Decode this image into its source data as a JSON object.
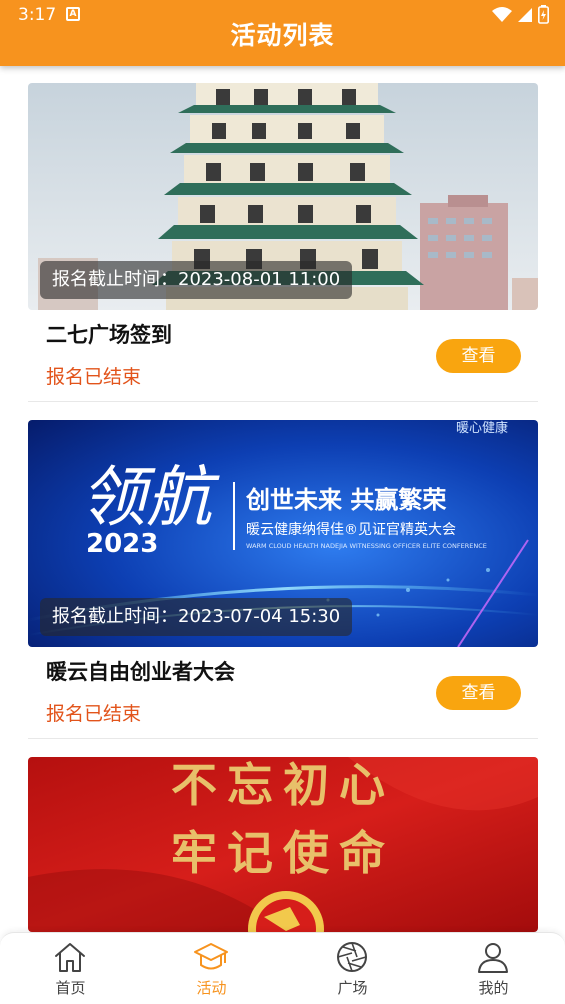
{
  "status_bar": {
    "time": "3:17",
    "notification_glyph": "A"
  },
  "header": {
    "title": "活动列表"
  },
  "events": [
    {
      "image": "pagoda-photo",
      "deadline": "报名截止时间：2023-08-01 11:00",
      "name": "二七广场签到",
      "status": "报名已结束",
      "action": "查看"
    },
    {
      "image": "conference-banner",
      "banner": {
        "corner_text": "暖心健康",
        "calligraphy": "领航",
        "year": "2023",
        "slogan": "创世未来   共赢繁荣",
        "subtitle": "暖云健康纳得佳®见证官精英大会",
        "subtitle_en": "WARM CLOUD HEALTH NADEJIA WITNESSING OFFICER ELITE CONFERENCE"
      },
      "deadline": "报名截止时间：2023-07-04 15:30",
      "name": "暖云自由创业者大会",
      "status": "报名已结束",
      "action": "查看"
    },
    {
      "image": "party-banner",
      "banner": {
        "line1": "不忘初心",
        "line2": "牢记使命"
      }
    }
  ],
  "tabbar": [
    {
      "label": "首页",
      "icon": "home-icon",
      "active": false
    },
    {
      "label": "活动",
      "icon": "graduation-cap-icon",
      "active": true
    },
    {
      "label": "广场",
      "icon": "aperture-icon",
      "active": false
    },
    {
      "label": "我的",
      "icon": "person-icon",
      "active": false
    }
  ],
  "colors": {
    "accent": "#f7931e",
    "button": "#f9a50f",
    "status_text": "#e2541b"
  }
}
